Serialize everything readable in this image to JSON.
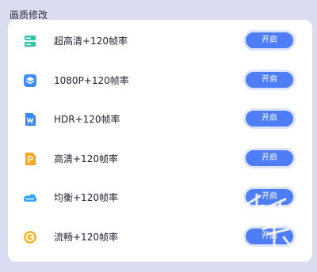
{
  "section": {
    "title": "画质修改"
  },
  "rows": [
    {
      "label": "超高清+120帧率",
      "button": "开启",
      "icon": "green-server-icon",
      "color": "#2fc5a4"
    },
    {
      "label": "1080P+120帧率",
      "button": "开启",
      "icon": "blue-layers-icon",
      "color": "#3d8bf7"
    },
    {
      "label": "HDR+120帧率",
      "button": "开启",
      "icon": "blue-document-w-icon",
      "color": "#3a86f5"
    },
    {
      "label": "高清+120帧率",
      "button": "开启",
      "icon": "orange-document-p-icon",
      "color": "#f6a623"
    },
    {
      "label": "均衡+120帧率",
      "button": "开启",
      "icon": "blue-cloud-icon",
      "color": "#36a6f0"
    },
    {
      "label": "流畅+120帧率",
      "button": "开启",
      "icon": "orange-circle-icon",
      "color": "#f7b52b"
    }
  ],
  "colors": {
    "background": "#dcdcf0",
    "card": "#ffffff",
    "button": "#4f7df5"
  }
}
